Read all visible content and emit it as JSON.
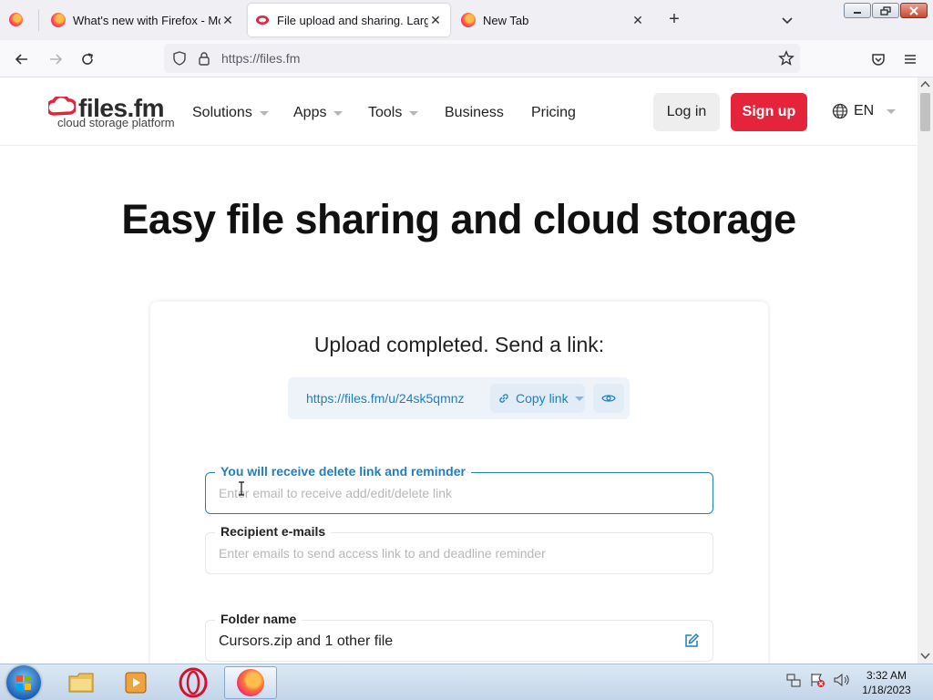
{
  "browser": {
    "tabs": [
      {
        "title": "What's new with Firefox - More",
        "active": false
      },
      {
        "title": "File upload and sharing. Large f",
        "active": true
      },
      {
        "title": "New Tab",
        "active": false
      }
    ],
    "address": "https://files.fm"
  },
  "site": {
    "logo_main": "files.fm",
    "logo_sub": "cloud storage platform",
    "menu": {
      "solutions": "Solutions",
      "apps": "Apps",
      "tools": "Tools",
      "business": "Business",
      "pricing": "Pricing"
    },
    "login": "Log in",
    "signup": "Sign up",
    "language": "EN",
    "accent_color": "#e5243b",
    "link_color": "#1f7fc2"
  },
  "main": {
    "hero_title": "Easy file sharing and cloud storage",
    "upload_title": "Upload completed. Send a link:",
    "share_url": "https://files.fm/u/24sk5qmnz",
    "copy_link": "Copy link",
    "owner_email": {
      "label": "You will receive delete link and reminder",
      "placeholder": "Enter email to receive add/edit/delete link",
      "value": ""
    },
    "recipient_emails": {
      "label": "Recipient e-mails",
      "placeholder": "Enter emails to send access link to and deadline reminder",
      "value": ""
    },
    "folder_name": {
      "label": "Folder name",
      "value": "Cursors.zip and 1 other file"
    }
  },
  "taskbar": {
    "time": "3:32 AM",
    "date": "1/18/2023"
  }
}
